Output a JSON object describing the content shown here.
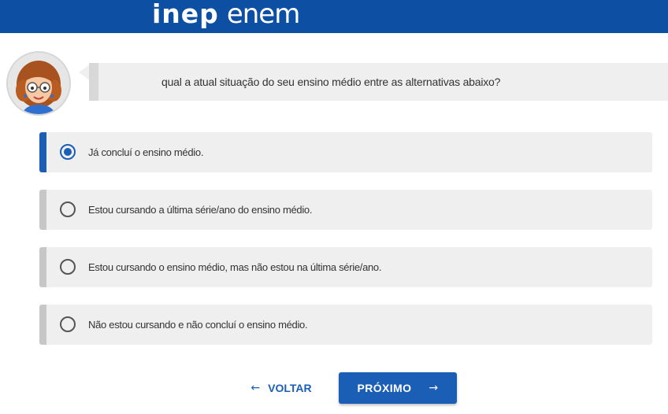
{
  "header": {
    "logo_inep": "inep",
    "logo_enem": "enem",
    "background_color": "#0c4fa3"
  },
  "assistant": {
    "avatar_icon": "assistant-avatar-icon",
    "message": "qual a atual situação do seu ensino médio entre as alternativas abaixo?"
  },
  "question": {
    "selected_index": 0,
    "options": [
      {
        "label": "Já concluí o ensino médio.",
        "selected": true
      },
      {
        "label": "Estou cursando a última série/ano do ensino médio.",
        "selected": false
      },
      {
        "label": "Estou cursando o ensino médio, mas não estou na última série/ano.",
        "selected": false
      },
      {
        "label": "Não estou cursando e não concluí o ensino médio.",
        "selected": false
      }
    ]
  },
  "navigation": {
    "back_label": "VOLTAR",
    "back_icon": "←",
    "next_label": "PRÓXIMO",
    "next_icon": "→"
  },
  "colors": {
    "accent": "#1b5eb5",
    "option_bg": "#efefef"
  }
}
